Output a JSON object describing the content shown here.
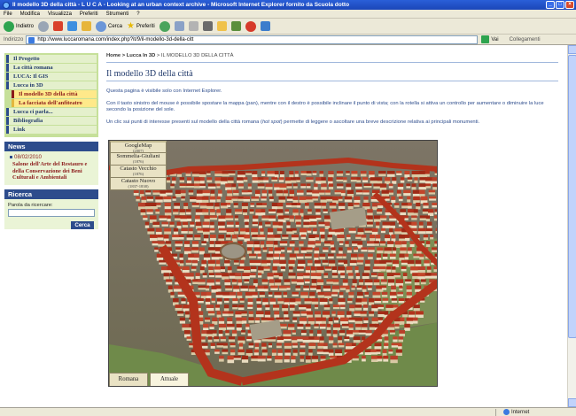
{
  "window": {
    "title": "Il modello 3D della città - L U C A - Looking at an urban context archive - Microsoft Internet Explorer fornito da Scuola dotto"
  },
  "menu": [
    "File",
    "Modifica",
    "Visualizza",
    "Preferiti",
    "Strumenti",
    "?"
  ],
  "toolbar": {
    "back_label": "Indietro",
    "search_label": "Cerca",
    "favorites_label": "Preferiti"
  },
  "address": {
    "label": "Indirizzo",
    "url": "http://www.luccaromana.com/index.php?it/9/il-modello-3d-della-citt",
    "go_label": "Vai",
    "links_label": "Collegamenti"
  },
  "sidebar": {
    "nav": [
      {
        "label": "Il Progetto",
        "style": "normal"
      },
      {
        "label": "La città romana",
        "style": "normal"
      },
      {
        "label": "LUCA: Il GIS",
        "style": "normal"
      },
      {
        "label": "Lucca in 3D",
        "style": "normal"
      },
      {
        "label": "Il modello 3D della città",
        "style": "active"
      },
      {
        "label": "La facciata dell'anfiteatro",
        "style": "sub"
      },
      {
        "label": "Lucca ci parla...",
        "style": "normal"
      },
      {
        "label": "Bibliografia",
        "style": "normal"
      },
      {
        "label": "Link",
        "style": "normal"
      }
    ],
    "news": {
      "heading": "News",
      "date": "08/02/2010",
      "text": "Salone dell'Arte del Restauro e della Conservazione dei Beni Culturali e Ambientali"
    },
    "search": {
      "heading": "Ricerca",
      "label": "Parola da ricercare:",
      "button": "Cerca"
    }
  },
  "main": {
    "breadcrumb": {
      "home": "Home",
      "sep1": " > ",
      "section": "Lucca In 3D",
      "sep2": " > ",
      "current": "IL MODELLO 3D DELLA CITTÀ"
    },
    "title": "Il modello 3D della città",
    "para1": "Questa pagina è visibile solo con Internet Explorer.",
    "para2": "Con il tasto sinistro del mouse è possibile spostare la mappa (pan), mentre con il destro è possibile inclinare il punto di vista; con la rotella si attiva un controllo per aumentare o diminuire la luce secondo la posizione del sole.",
    "para3_a": "Un clic sui punti di interesse presenti sul modello della città romana (",
    "para3_em": "hot spot",
    "para3_b": ") permette di leggere o ascoltare una breve descrizione relativa ai principali monumenti."
  },
  "map": {
    "layers": [
      {
        "label": "GoogleMap",
        "note": "(2007)"
      },
      {
        "label": "Sommelia-Giuliani",
        "note": "(1876)"
      },
      {
        "label": "Catasto Vecchio",
        "note": "(1876)"
      },
      {
        "label": "Catasto Nuovo",
        "note": "(1837-1838)"
      }
    ],
    "bottom_tabs": [
      "Romana",
      "Attuale"
    ],
    "active_tab": "Attuale"
  },
  "status": {
    "zone": "Internet"
  },
  "colors": {
    "nav_bg": "#c6e09a",
    "heading_blue": "#2d4c8c",
    "accent_red": "#8b1a1a",
    "roof_red": "#b3331c"
  }
}
